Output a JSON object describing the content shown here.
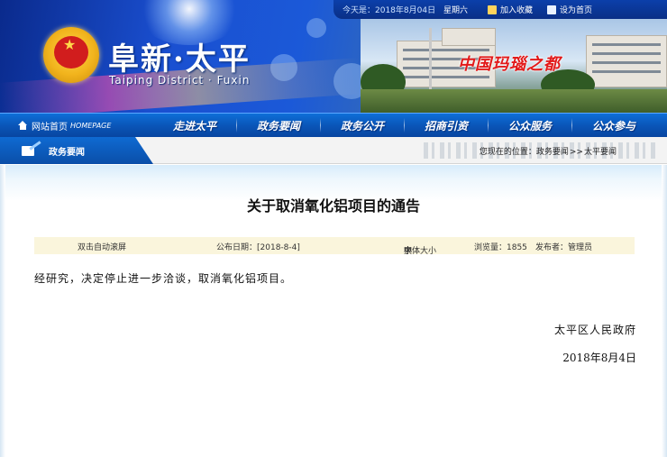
{
  "header": {
    "date_label": "今天是：2018年8月04日",
    "weekday": "星期六",
    "bookmark_label": "加入收藏",
    "homepage_label": "设为首页",
    "site_title": "阜新·太平",
    "site_subtitle": "Taiping District · Fuxin",
    "slogan": "中国玛瑙之都"
  },
  "nav": {
    "home_label": "网站首页",
    "home_en": "HOMEPAGE",
    "items": [
      {
        "label": "走进太平"
      },
      {
        "label": "政务要闻"
      },
      {
        "label": "政务公开"
      },
      {
        "label": "招商引资"
      },
      {
        "label": "公众服务"
      },
      {
        "label": "公众参与"
      }
    ]
  },
  "section": {
    "tab_label": "政务要闻",
    "breadcrumb_prefix": "您现在的位置：",
    "breadcrumb_1": "政务要闻",
    "breadcrumb_sep": ">>",
    "breadcrumb_2": "太平要闻"
  },
  "article": {
    "title": "关于取消氧化铝项目的通告",
    "meta": {
      "dblclick_scroll": "双击自动滚屏",
      "publish_date": "公布日期：[2018-8-4]",
      "font_size_label": "字体大小",
      "font_small": "小",
      "font_medium": "中",
      "font_large": "大",
      "views": "浏览量：1855",
      "publisher": "发布者：管理员"
    },
    "body": "经研究，决定停止进一步洽谈，取消氧化铝项目。",
    "signature_org": "太平区人民政府",
    "signature_date": "2018年8月4日"
  },
  "colors": {
    "banner_blue": "#1a4fd0",
    "nav_blue": "#0a56b9",
    "slogan_red": "#e21a1a",
    "meta_bg": "#faf5dc"
  }
}
